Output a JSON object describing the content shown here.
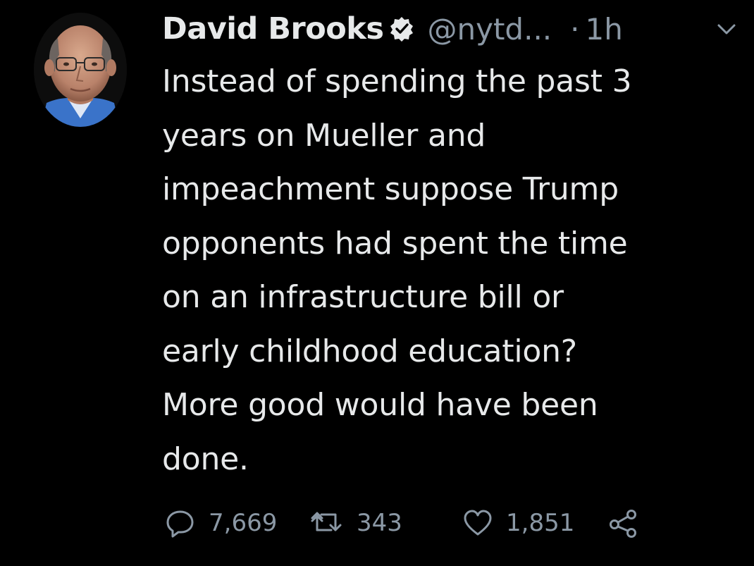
{
  "tweet": {
    "author_name": "David Brooks",
    "handle": "@nytd...",
    "separator": "·",
    "time": "1h",
    "body_lines": [
      "Instead of spending the past 3",
      "years on Mueller and",
      "impeachment suppose Trump",
      "opponents had spent the time",
      "on an infrastructure bill or",
      "early childhood education?",
      "More good would have been",
      "done."
    ],
    "actions": {
      "replies": "7,669",
      "retweets": "343",
      "likes": "1,851"
    }
  },
  "icons": {
    "verified": "verified-badge-icon",
    "caret": "chevron-down-icon",
    "reply": "reply-icon",
    "retweet": "retweet-icon",
    "like": "heart-icon",
    "share": "share-icon"
  },
  "colors": {
    "background": "#000000",
    "text_primary": "#e7e9ea",
    "text_secondary": "#8b98a5"
  }
}
